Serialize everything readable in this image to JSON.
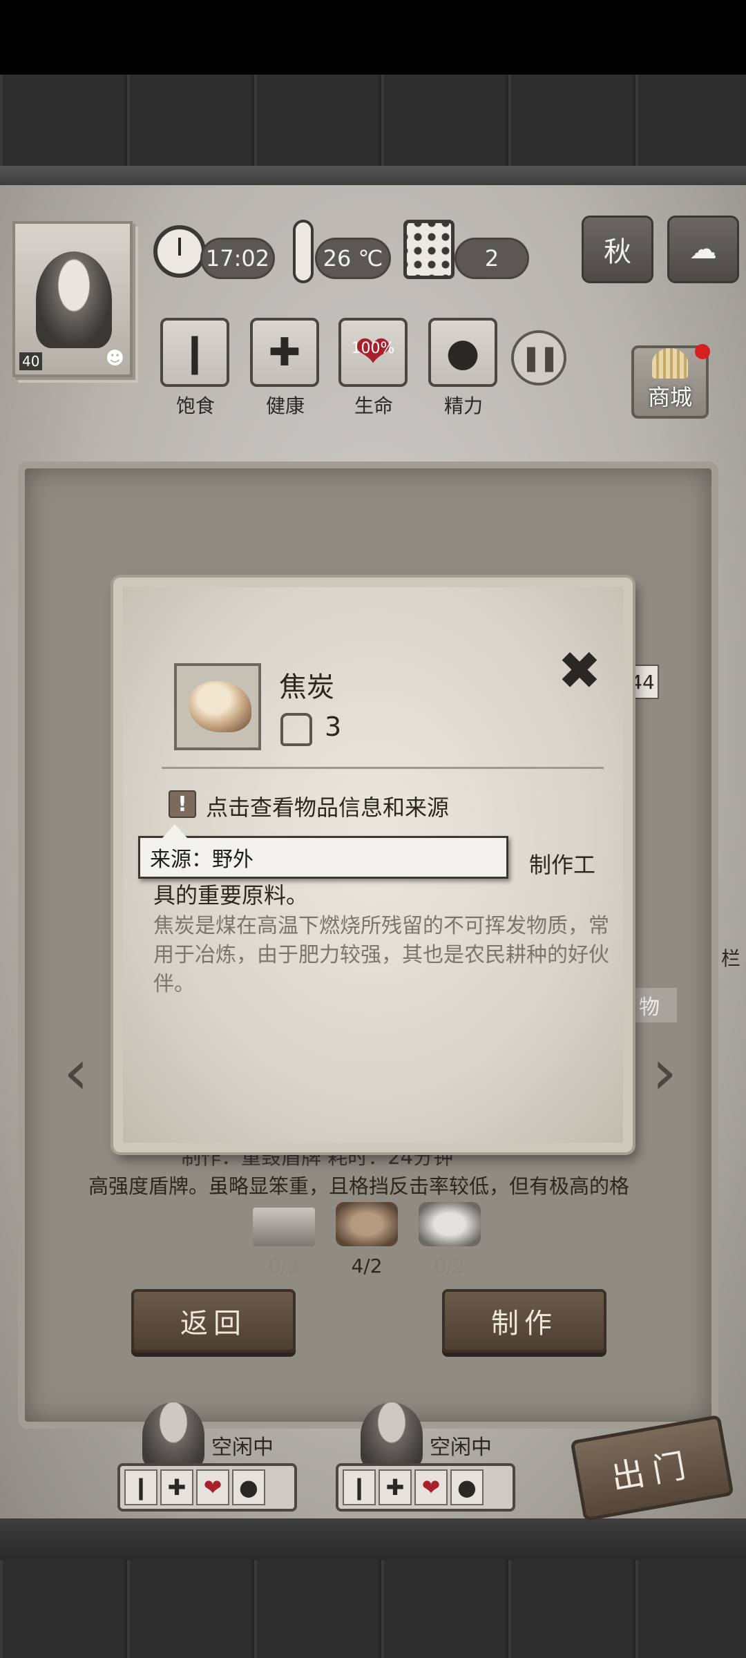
{
  "hud": {
    "time": "17:02",
    "temperature": "26 ℃",
    "day": "2",
    "season": "秋",
    "weather_icon": "cloud-icon",
    "level": "40"
  },
  "stats": [
    {
      "label": "饱食",
      "icon": "stomach-icon"
    },
    {
      "label": "健康",
      "icon": "cross-icon"
    },
    {
      "label": "生命",
      "icon": "heart-icon",
      "value": "100%"
    },
    {
      "label": "精力",
      "icon": "person-icon"
    }
  ],
  "shop": {
    "label": "商城"
  },
  "background_panel": {
    "side_number": "44",
    "side_label_right": "物",
    "side_label_far_right": "栏",
    "craft_line": "制作：重毁盾牌      耗时：24分钟",
    "craft_description": "高强度盾牌。虽略显笨重，且格挡反击率较低，但有极高的格",
    "materials": [
      {
        "name": "plank",
        "count": "0/3"
      },
      {
        "name": "coke",
        "count": "4/2"
      },
      {
        "name": "iron-ore",
        "count": "0/2"
      }
    ],
    "back_button": "返回",
    "craft_button": "制作"
  },
  "workers": [
    {
      "status": "空闲中"
    },
    {
      "status": "空闲中"
    }
  ],
  "exit_button": "出门",
  "dialog": {
    "item_name": "焦炭",
    "item_count": "3",
    "hint": "点击查看物品信息和来源",
    "use_text_tail": "制作工",
    "use_text_line2": "具的重要原料。",
    "description": "焦炭是煤在高温下燃烧所残留的不可挥发物质，常用于冶炼，由于肥力较强，其也是农民耕种的好伙伴。",
    "tooltip": "来源：野外"
  },
  "colors": {
    "panel": "#908c84",
    "dialog_paper": "#e3ded4",
    "heart": "#a8202b",
    "shop_dot": "#d81f1f"
  }
}
